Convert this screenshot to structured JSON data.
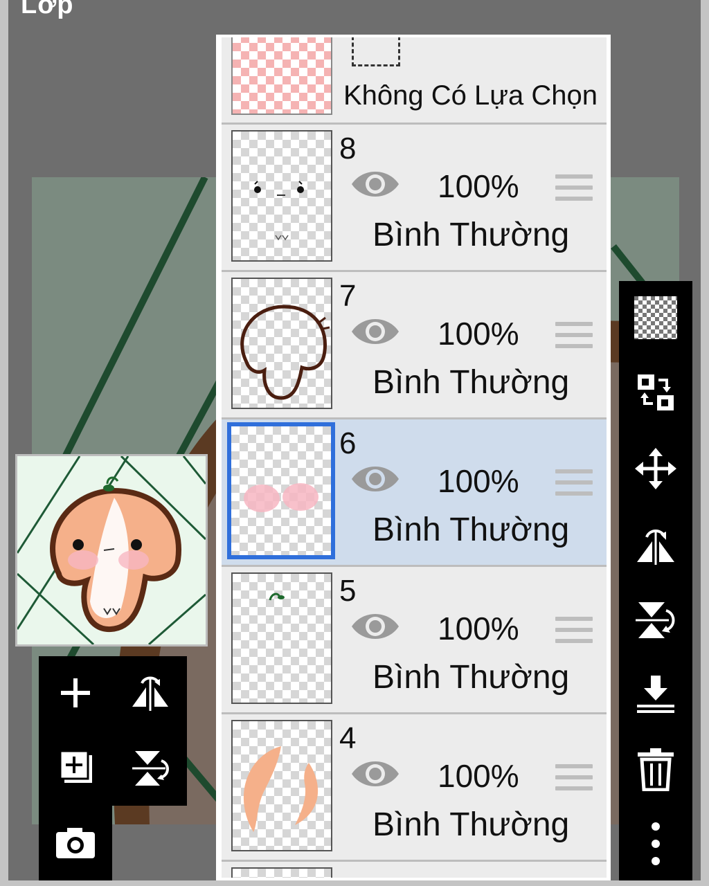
{
  "window": {
    "title": "Lớp"
  },
  "layers_panel": {
    "selection_layer": {
      "label": "Không Có Lựa Chọn"
    },
    "layers": [
      {
        "name": "8",
        "opacity": "100%",
        "blend": "Bình Thường",
        "selected": false
      },
      {
        "name": "7",
        "opacity": "100%",
        "blend": "Bình Thường",
        "selected": false
      },
      {
        "name": "6",
        "opacity": "100%",
        "blend": "Bình Thường",
        "selected": true
      },
      {
        "name": "5",
        "opacity": "100%",
        "blend": "Bình Thường",
        "selected": false
      },
      {
        "name": "4",
        "opacity": "100%",
        "blend": "Bình Thường",
        "selected": false
      }
    ]
  },
  "left_tools": [
    "add-layer-icon",
    "flip-horizontal-icon",
    "copy-layer-icon",
    "flip-vertical-icon",
    "camera-icon"
  ],
  "right_tools": [
    "transparency-icon",
    "swap-selection-icon",
    "move-icon",
    "flip-horizontal-rotate-icon",
    "flip-vertical-rotate-icon",
    "merge-down-icon",
    "trash-icon",
    "more-icon"
  ],
  "colors": {
    "selected_row": "#cfdcec",
    "selected_border": "#2f6fdb",
    "panel_bg": "#ececec",
    "toolbar": "#000000",
    "canvas_line": "#1e4a2e",
    "canvas_brown": "#5b3a22"
  }
}
